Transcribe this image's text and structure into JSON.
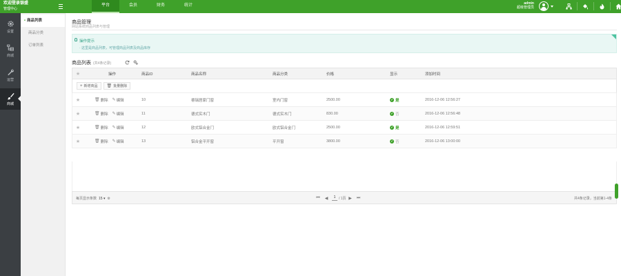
{
  "brand": {
    "title": "欢迎登录银盛",
    "subtitle": "管理中心"
  },
  "topnav": {
    "tabs": [
      {
        "label": "平台",
        "active": true
      },
      {
        "label": "会员",
        "active": false
      },
      {
        "label": "财务",
        "active": false
      },
      {
        "label": "统计",
        "active": false
      }
    ]
  },
  "user": {
    "name": "admin",
    "role": "超级管理员"
  },
  "top_icons": [
    "sitemap-icon",
    "clear-cache-icon",
    "fire-icon",
    "home-icon",
    "power-icon"
  ],
  "rail": {
    "items": [
      {
        "label": "设置",
        "icon": "gear-icon",
        "active": false
      },
      {
        "label": "商城",
        "icon": "sitemap-icon",
        "active": false
      },
      {
        "label": "运营",
        "icon": "wrench-icon",
        "active": false
      },
      {
        "label": "商城",
        "icon": "brush-icon",
        "active": true
      }
    ]
  },
  "submenu": {
    "items": [
      {
        "label": "商品列表",
        "active": true
      },
      {
        "label": "商品分类",
        "active": false
      },
      {
        "label": "订单列表",
        "active": false
      }
    ]
  },
  "page": {
    "title": "商品管理",
    "subtitle": "网站系统商品列表与管理"
  },
  "tips": {
    "title": "操作提示",
    "text": "· 这里是商品列表，可管理商品列表及商品库存"
  },
  "list": {
    "title": "商品列表",
    "count": "(共4条记录)"
  },
  "columns": {
    "op": "操作",
    "id": "商品ID",
    "name": "商品名称",
    "cat": "商品分类",
    "price": "价格",
    "show": "显示",
    "time": "添加时间"
  },
  "toolbar": {
    "add": "新增商品",
    "batch_delete": "批量删除"
  },
  "ops": {
    "delete": "删除",
    "edit": "编辑"
  },
  "rows": [
    {
      "id": "10",
      "name": "睿瑞居家门窗",
      "cat": "室内门窗",
      "price": "2500.00",
      "show": "是",
      "shown": true,
      "time": "2016-12-06 12:56:27"
    },
    {
      "id": "11",
      "name": "德式实木门",
      "cat": "德式实木门",
      "price": "830.00",
      "show": "否",
      "shown": false,
      "time": "2016-12-06 12:56:48"
    },
    {
      "id": "12",
      "name": "欧式铝合金门",
      "cat": "欧式铝合金门",
      "price": "2500.00",
      "show": "是",
      "shown": true,
      "time": "2016-12-06 12:59:51"
    },
    {
      "id": "13",
      "name": "铝合金平开窗",
      "cat": "平开窗",
      "price": "3800.00",
      "show": "否",
      "shown": false,
      "time": "2016-12-06 13:00:00"
    }
  ],
  "pager": {
    "per_page_label": "每页显示条数",
    "per_page": "15",
    "page": "1",
    "total_pages": "/ 1页",
    "summary": "共4条记录，当前第1-4条"
  },
  "colors": {
    "brand": "#3fa12a",
    "rail": "#3b3f43",
    "tips_bg": "#e9f7f4"
  }
}
